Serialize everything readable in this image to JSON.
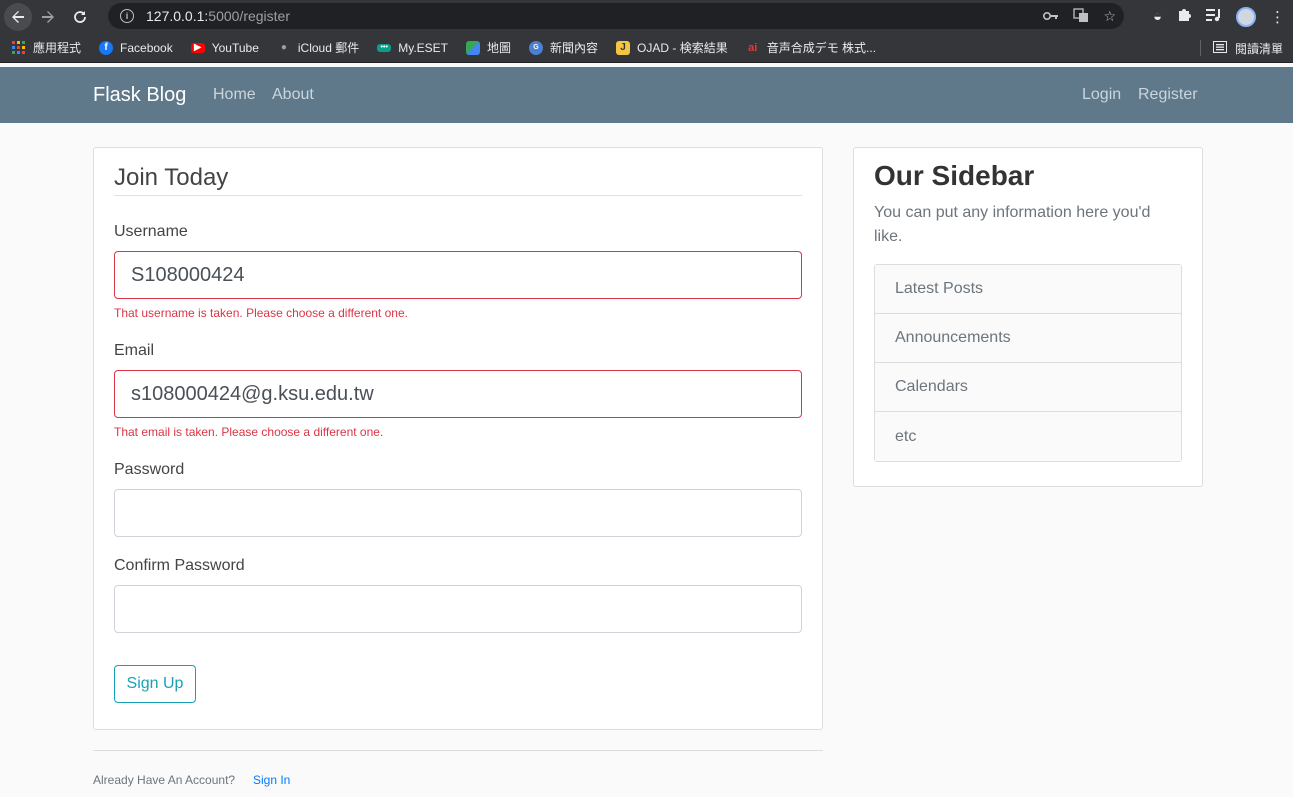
{
  "browser": {
    "url_host": "127.0.0.1:",
    "url_path": "5000/register",
    "bookmarks": [
      {
        "label": "應用程式",
        "icon": "apps-grid-icon"
      },
      {
        "label": "Facebook",
        "icon": "facebook-icon"
      },
      {
        "label": "YouTube",
        "icon": "youtube-icon"
      },
      {
        "label": "iCloud 郵件",
        "icon": "apple-icon"
      },
      {
        "label": "My.ESET",
        "icon": "eset-icon"
      },
      {
        "label": "地圖",
        "icon": "maps-icon"
      },
      {
        "label": "新聞內容",
        "icon": "news-icon"
      },
      {
        "label": "OJAD - 検索結果",
        "icon": "ojad-icon"
      },
      {
        "label": "音声合成デモ 株式...",
        "icon": "voice-demo-icon"
      }
    ],
    "reading_list": "閱讀清單"
  },
  "navbar": {
    "brand": "Flask Blog",
    "home": "Home",
    "about": "About",
    "login": "Login",
    "register": "Register"
  },
  "form": {
    "legend": "Join Today",
    "username_label": "Username",
    "username_value": "S108000424",
    "username_error": "That username is taken. Please choose a different one.",
    "email_label": "Email",
    "email_value": "s108000424@g.ksu.edu.tw",
    "email_error": "That email is taken. Please choose a different one.",
    "password_label": "Password",
    "password_value": "",
    "confirm_label": "Confirm Password",
    "confirm_value": "",
    "submit": "Sign Up"
  },
  "footer": {
    "prompt": "Already Have An Account?",
    "signin": "Sign In"
  },
  "sidebar": {
    "title": "Our Sidebar",
    "text": "You can put any information here you'd like.",
    "items": [
      "Latest Posts",
      "Announcements",
      "Calendars",
      "etc"
    ]
  },
  "colors": {
    "navbar": "#5f788a",
    "error": "#dc3545",
    "button": "#17a2b8",
    "link": "#007bff"
  }
}
